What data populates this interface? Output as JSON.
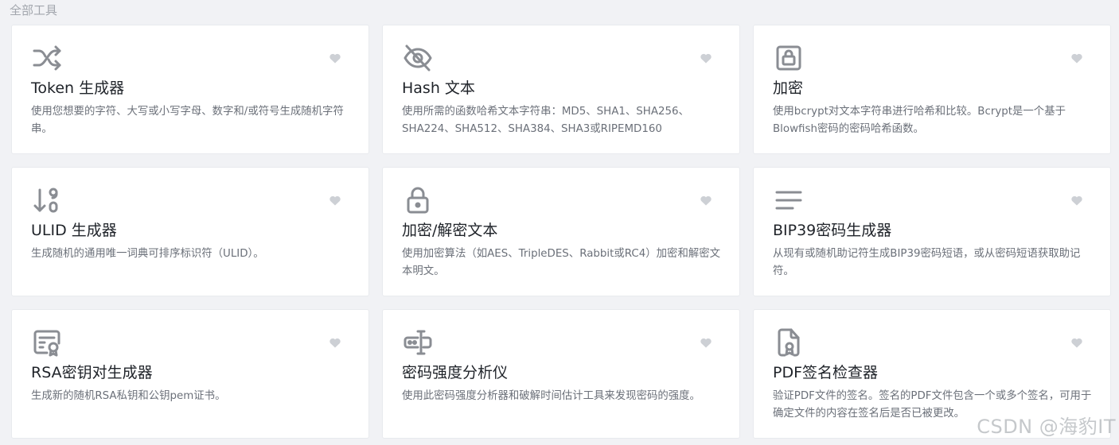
{
  "section_title": "全部工具",
  "colors": {
    "icon": "#8a8d93",
    "heart": "#cdd0d5",
    "title": "#1f2329",
    "desc": "#6b7079"
  },
  "tools": [
    {
      "icon": "shuffle-icon",
      "title": "Token 生成器",
      "desc": "使用您想要的字符、大写或小写字母、数字和/或符号生成随机字符串。"
    },
    {
      "icon": "eye-off-icon",
      "title": "Hash 文本",
      "desc": "使用所需的函数哈希文本字符串：MD5、SHA1、SHA256、SHA224、SHA512、SHA384、SHA3或RIPEMD160"
    },
    {
      "icon": "lock-square-icon",
      "title": "加密",
      "desc": "使用bcrypt对文本字符串进行哈希和比较。Bcrypt是一个基于Blowfish密码的密码哈希函数。"
    },
    {
      "icon": "sort-numeric-icon",
      "title": "ULID 生成器",
      "desc": "生成随机的通用唯一词典可排序标识符（ULID）。"
    },
    {
      "icon": "lock-icon",
      "title": "加密/解密文本",
      "desc": "使用加密算法（如AES、TripleDES、Rabbit或RC4）加密和解密文本明文。"
    },
    {
      "icon": "align-justified-icon",
      "title": "BIP39密码生成器",
      "desc": "从现有或随机助记符生成BIP39密码短语，或从密码短语获取助记符。"
    },
    {
      "icon": "certificate-icon",
      "title": "RSA密钥对生成器",
      "desc": "生成新的随机RSA私钥和公钥pem证书。"
    },
    {
      "icon": "password-icon",
      "title": "密码强度分析仪",
      "desc": "使用此密码强度分析器和破解时间估计工具来发现密码的强度。"
    },
    {
      "icon": "file-certificate-icon",
      "title": "PDF签名检查器",
      "desc": "验证PDF文件的签名。签名的PDF文件包含一个或多个签名，可用于确定文件的内容在签名后是否已被更改。"
    }
  ],
  "watermark": "CSDN @海豹IT"
}
